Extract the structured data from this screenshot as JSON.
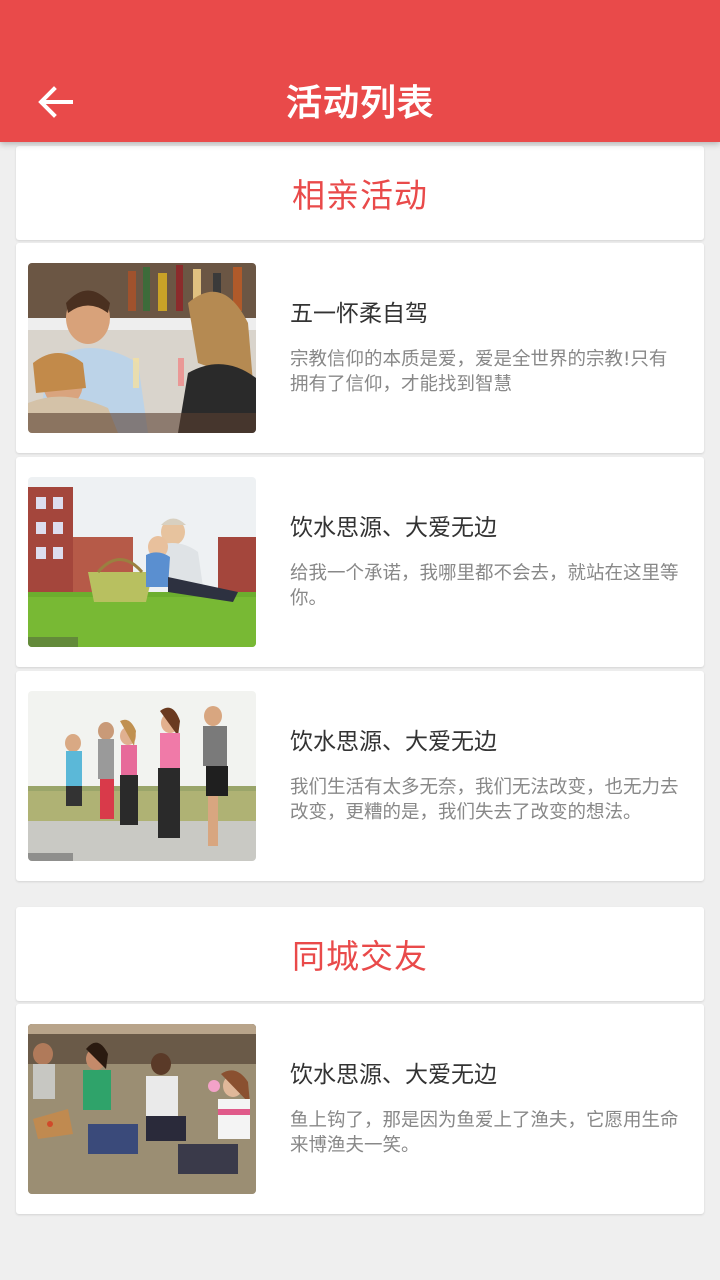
{
  "header": {
    "title": "活动列表",
    "back_icon": "arrow-left-icon",
    "color": "#e94a4a"
  },
  "sections": [
    {
      "title": "相亲活动",
      "items": [
        {
          "title": "五一怀柔自驾",
          "desc": "宗教信仰的本质是爱，爱是全世界的宗教!只有拥有了信仰，才能找到智慧",
          "image": "friends-bar-photo"
        },
        {
          "title": "饮水思源、大爱无边",
          "desc": "给我一个承诺，我哪里都不会去，就站在这里等你。",
          "image": "family-picnic-photo"
        },
        {
          "title": "饮水思源、大爱无边",
          "desc": "我们生活有太多无奈，我们无法改变，也无力去改变，更糟的是，我们失去了改变的想法。",
          "image": "runners-photo"
        }
      ]
    },
    {
      "title": "同城交友",
      "items": [
        {
          "title": "饮水思源、大爱无边",
          "desc": "鱼上钩了，那是因为鱼爱上了渔夫，它愿用生命来博渔夫一笑。",
          "image": "teens-sitting-photo"
        }
      ]
    }
  ]
}
